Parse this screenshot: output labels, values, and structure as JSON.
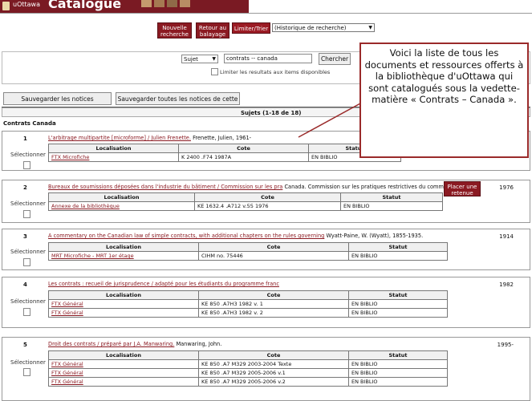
{
  "header": {
    "institution": "uOttawa",
    "title": "Catalogue"
  },
  "toolbar": {
    "new_search_label": "Nouvelle recherche",
    "back_label": "Retour au balayage",
    "limit_sort_label": "Limiter/Trier",
    "history_select_value": "(Historique de recherche)"
  },
  "search": {
    "field_value": "Sujet",
    "query_value": "contrats -- canada",
    "search_button": "Chercher",
    "limit_label": "Limiter les resultats aux items disponibles"
  },
  "actions": {
    "save_selected": "Sauvegarder les notices sélectionnées",
    "save_page": "Sauvegarder toutes les notices de cette page"
  },
  "results": {
    "header": "Sujets (1-18 de 18)",
    "group_label": "Contrats Canada",
    "select_label": "Sélectionner",
    "columns": [
      "Localisation",
      "Cote",
      "Statut"
    ],
    "hold_label": "Placer une retenue",
    "records": [
      {
        "num": "1",
        "title": "L'arbitrage multipartite [microforme] / Julien Frenette.",
        "author": "Frenette, Julien, 1961-",
        "year": "",
        "rows": [
          [
            "FTX Microfiche",
            "K 2400 .F74 1987A",
            "EN BIBLIO"
          ]
        ]
      },
      {
        "num": "2",
        "title": "Bureaux de soumissions déposées dans l'industrie du bâtiment / Commission sur les pra",
        "author": "Canada. Commission sur les pratiques restrictives du commerce.",
        "year": "1976",
        "rows": [
          [
            "Annexe de la bibliothèque",
            "KE 1632.4 .A712 v.55 1976",
            "EN BIBLIO"
          ]
        ]
      },
      {
        "num": "3",
        "title": "A commentary on the Canadian law of simple contracts, with additional chapters on the rules governing",
        "author": "Wyatt-Paine, W. (Wyatt), 1855-1935.",
        "year": "1914",
        "rows": [
          [
            "MRT Microfiche - MRT 1er étage",
            "CIHM no. 75446",
            "EN BIBLIO"
          ]
        ]
      },
      {
        "num": "4",
        "title": "Les contrats : recueil de jurisprudence / adapté pour les étudiants du programme franc",
        "author": "",
        "year": "1982",
        "rows": [
          [
            "FTX Général",
            "KE 850 .A7H3 1982 v. 1",
            "EN BIBLIO"
          ],
          [
            "FTX Général",
            "KE 850 .A7H3 1982 v. 2",
            "EN BIBLIO"
          ]
        ]
      },
      {
        "num": "5",
        "title": "Droit des contrats / préparé par J.A. Manwaring.",
        "author": "Manwaring, John.",
        "year": "1995-",
        "rows": [
          [
            "FTX Général",
            "KE 850 .A7 M329 2003-2004 Texte",
            "EN BIBLIO"
          ],
          [
            "FTX Général",
            "KE 850 .A7 M329 2005-2006 v.1",
            "EN BIBLIO"
          ],
          [
            "FTX Général",
            "KE 850 .A7 M329 2005-2006 v.2",
            "EN BIBLIO"
          ]
        ]
      }
    ]
  },
  "callout": {
    "text": "Voici la liste de tous les documents et ressources offerts à la bibliothèque d'uOttawa qui sont catalogués sous la vedette-matière « Contrats – Canada »."
  },
  "colors": {
    "brand": "#7a1a23",
    "link": "#8b1a22",
    "callout_border": "#9a2a2a"
  }
}
